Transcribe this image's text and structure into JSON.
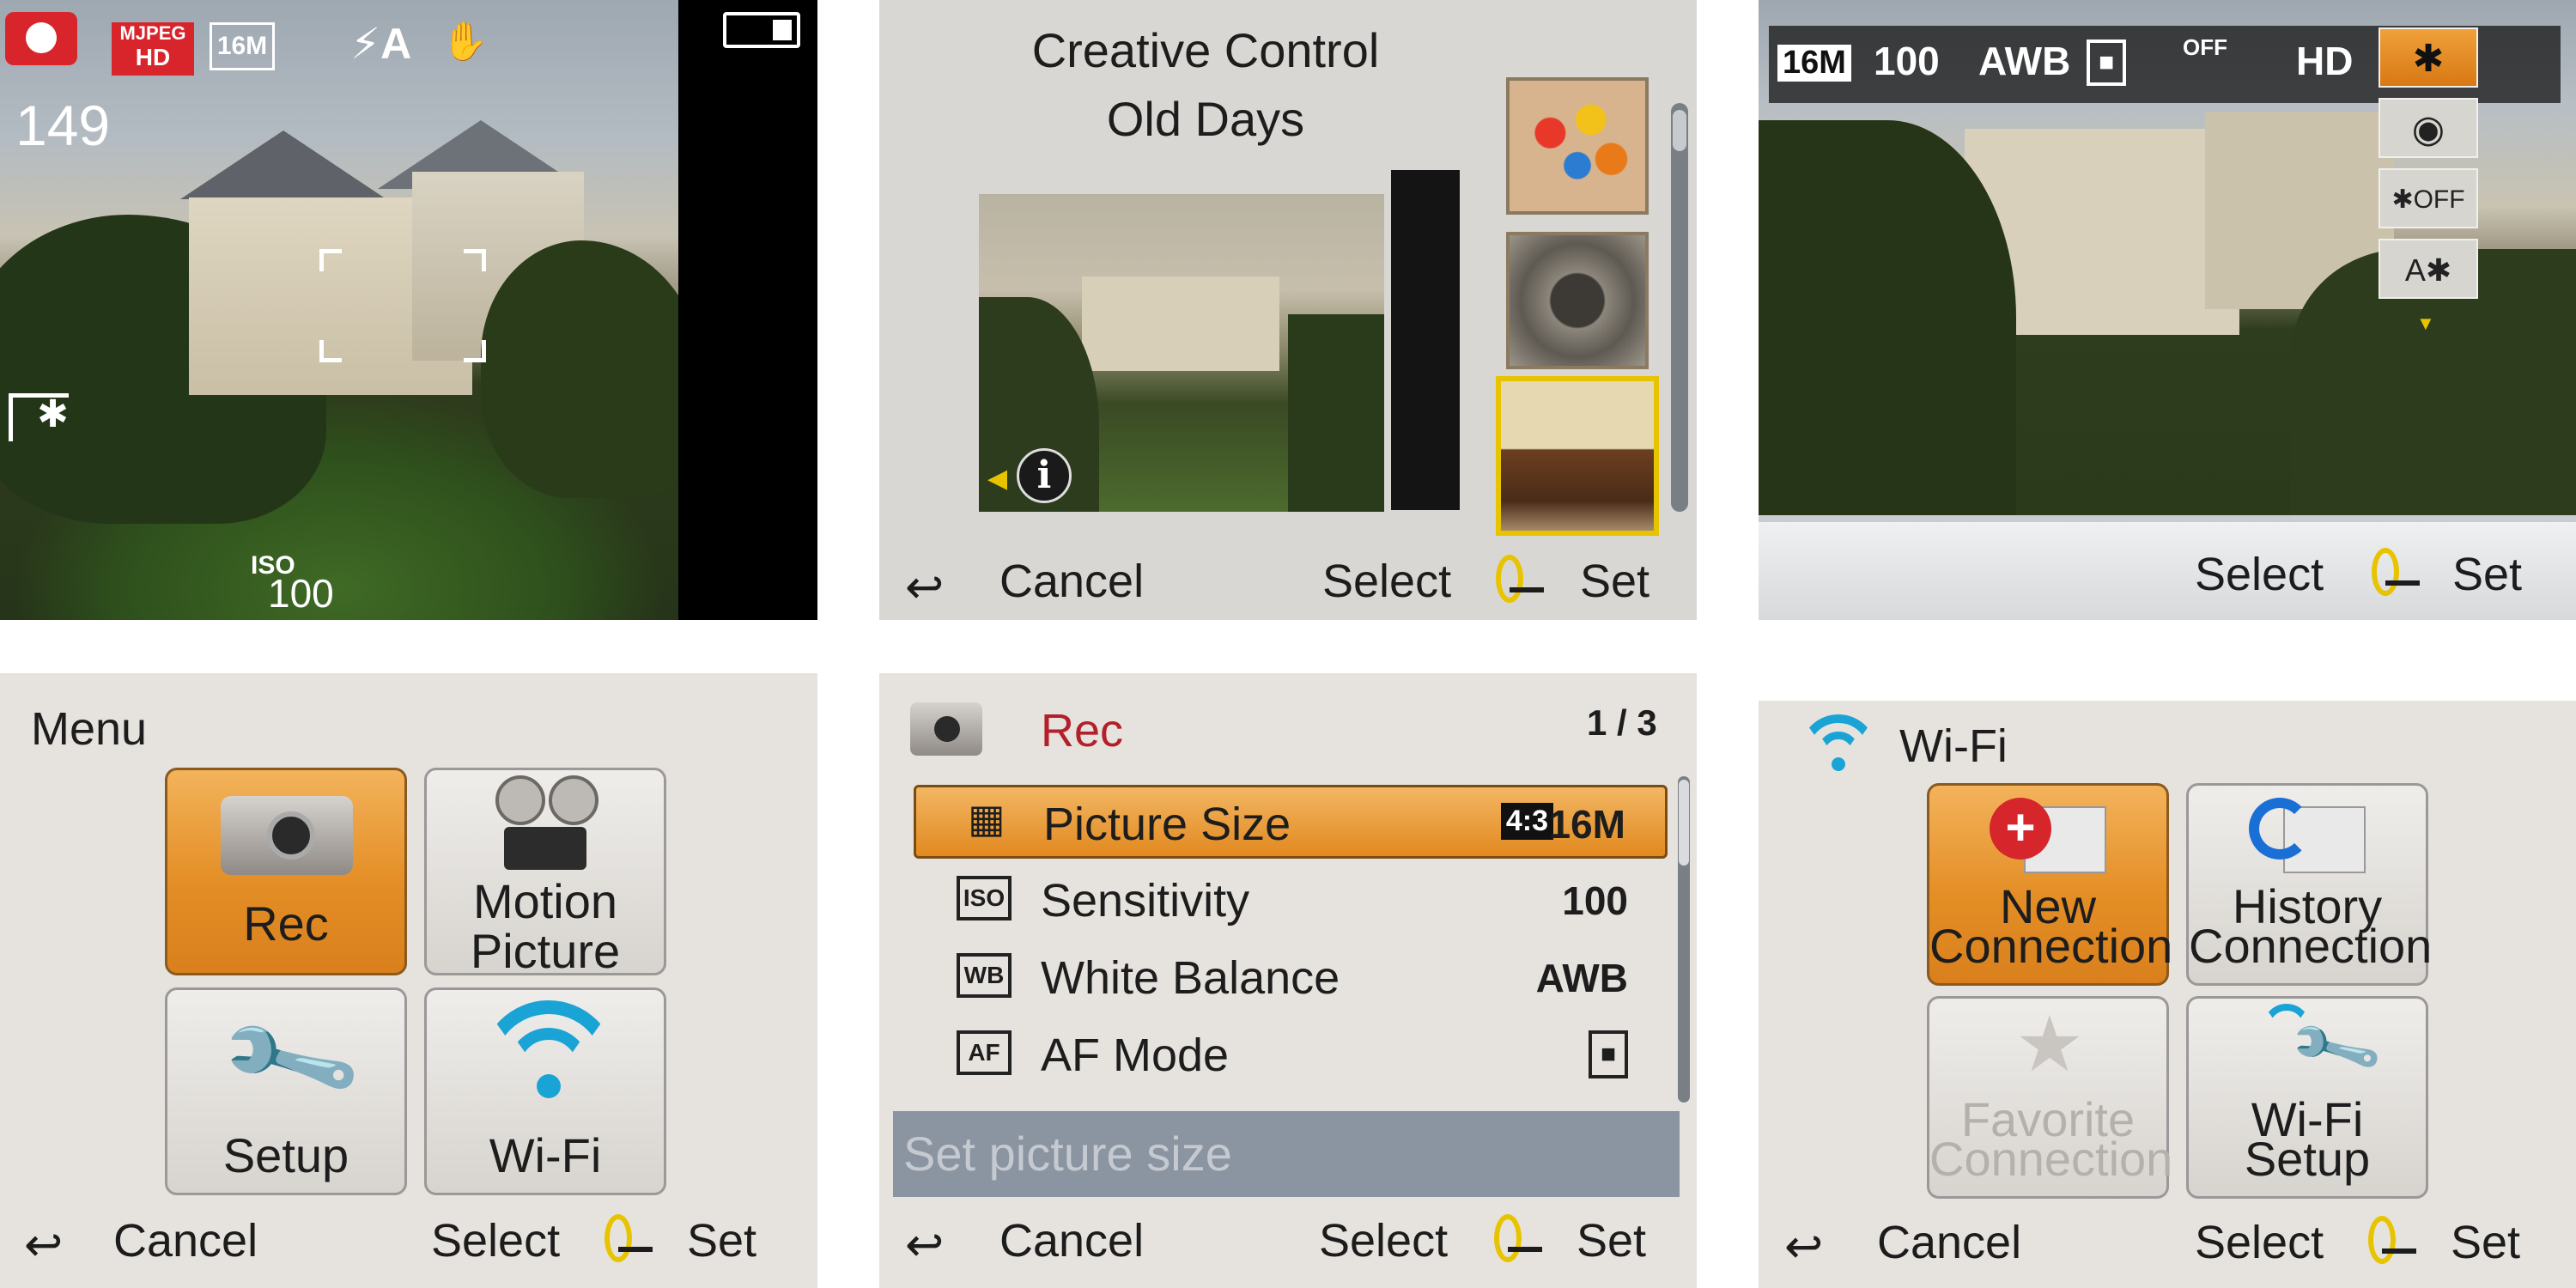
{
  "live_view": {
    "shots_remaining": "149",
    "video_format_top": "MJPEG",
    "video_format_bottom": "HD",
    "picture_size": "16M",
    "flash_mode": "⚡A",
    "iso_label": "ISO",
    "iso_value": "100"
  },
  "creative_control": {
    "title_line1": "Creative Control",
    "title_line2": "Old Days",
    "cancel_label": "Cancel",
    "select_label": "Select",
    "set_label": "Set"
  },
  "quick_menu": {
    "items": [
      "16M",
      "100",
      "AWB",
      "■",
      "OFF",
      "HD"
    ],
    "select_label": "Select",
    "set_label": "Set"
  },
  "main_menu": {
    "title": "Menu",
    "tiles": [
      "Rec",
      "Motion\nPicture",
      "Setup",
      "Wi-Fi"
    ],
    "cancel_label": "Cancel",
    "select_label": "Select",
    "set_label": "Set"
  },
  "rec_menu": {
    "title": "Rec",
    "page": "1 / 3",
    "rows": [
      {
        "icon": "▦",
        "label": "Picture Size",
        "value_aspect": "4:3",
        "value": "16M"
      },
      {
        "icon": "ISO",
        "label": "Sensitivity",
        "value": "100"
      },
      {
        "icon": "WB",
        "label": "White Balance",
        "value": "AWB"
      },
      {
        "icon": "AF",
        "label": "AF Mode",
        "value": "■"
      }
    ],
    "hint": "Set picture size",
    "cancel_label": "Cancel",
    "select_label": "Select",
    "set_label": "Set"
  },
  "wifi_menu": {
    "title": "Wi-Fi",
    "tiles": [
      {
        "line1": "New",
        "line2": "Connection"
      },
      {
        "line1": "History",
        "line2": "Connection"
      },
      {
        "line1": "Favorite",
        "line2": "Connection"
      },
      {
        "line1": "Wi-Fi",
        "line2": "Setup"
      }
    ],
    "cancel_label": "Cancel",
    "select_label": "Select",
    "set_label": "Set"
  },
  "colors": {
    "accent_orange": "#e48e26",
    "selection_yellow": "#e8c300",
    "rec_red": "#b3202a"
  }
}
